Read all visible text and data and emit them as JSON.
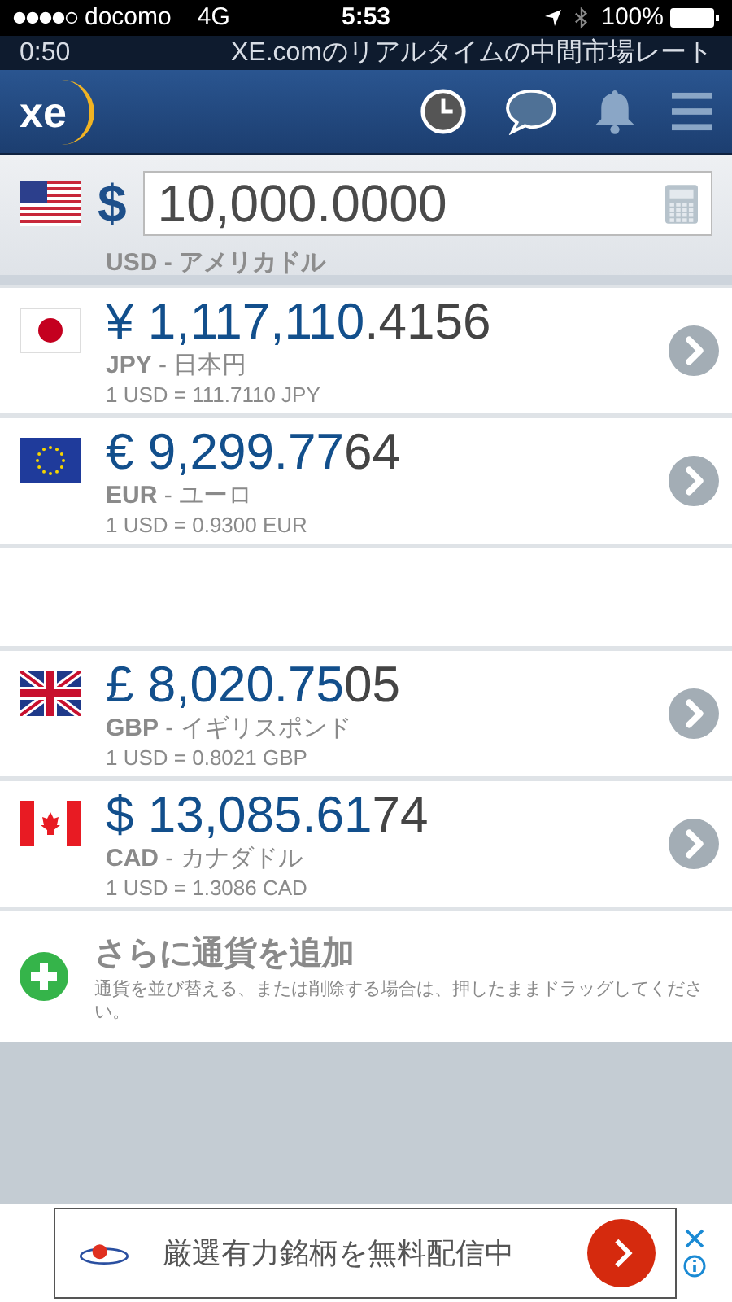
{
  "status_bar": {
    "carrier": "docomo",
    "network": "4G",
    "time": "5:53",
    "battery": "100%"
  },
  "ticker": {
    "time": "0:50",
    "text": "XE.comのリアルタイムの中間市場レート"
  },
  "header": {
    "logo": "xe"
  },
  "base": {
    "flag": {
      "kind": "us"
    },
    "symbol": "$",
    "amount": "10,000.0000",
    "label": "USD - アメリカドル"
  },
  "currencies": [
    {
      "flag": {
        "kind": "jp"
      },
      "amount_main": "¥ 1,117,110",
      "amount_extra": ".4156",
      "code": "JPY",
      "name": " - 日本円",
      "rate": "1 USD = 111.7110 JPY"
    },
    {
      "flag": {
        "kind": "eu"
      },
      "amount_main": "€ 9,299.77",
      "amount_extra": "64",
      "code": "EUR",
      "name": " - ユーロ",
      "rate": "1 USD = 0.9300 EUR"
    },
    {
      "kind": "spacer"
    },
    {
      "flag": {
        "kind": "gb"
      },
      "amount_main": "£ 8,020.75",
      "amount_extra": "05",
      "code": "GBP",
      "name": " - イギリスポンド",
      "rate": "1 USD = 0.8021 GBP"
    },
    {
      "flag": {
        "kind": "ca"
      },
      "amount_main": "$ 13,085.61",
      "amount_extra": "74",
      "code": "CAD",
      "name": " - カナダドル",
      "rate": "1 USD = 1.3086 CAD"
    }
  ],
  "add": {
    "title": "さらに通貨を追加",
    "hint": "通貨を並び替える、または削除する場合は、押したままドラッグしてください。"
  },
  "ad": {
    "text": "厳選有力銘柄を無料配信中"
  }
}
